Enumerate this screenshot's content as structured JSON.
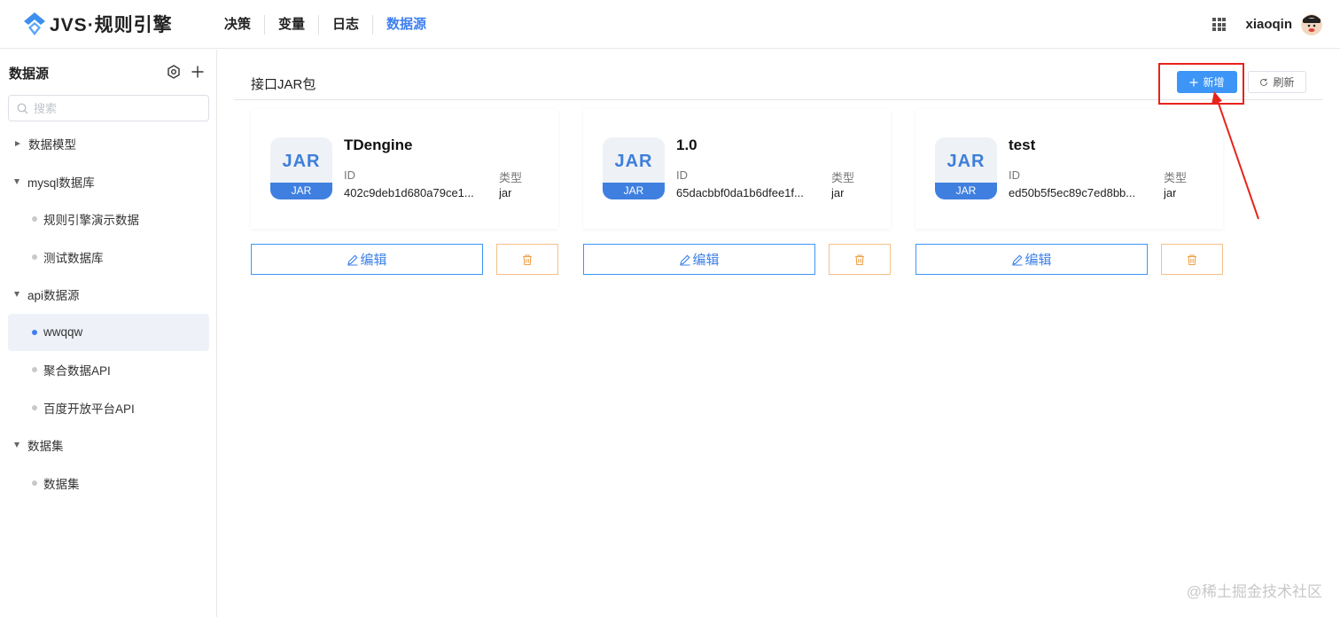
{
  "app": {
    "logo_text": "JVS·规则引擎"
  },
  "nav": {
    "items": [
      "决策",
      "变量",
      "日志",
      "数据源"
    ],
    "active_index": 3
  },
  "user": {
    "name": "xiaoqin"
  },
  "sidebar": {
    "title": "数据源",
    "search_placeholder": "搜索",
    "tree": [
      {
        "label": "数据模型",
        "type": "group",
        "expanded": false
      },
      {
        "label": "mysql数据库",
        "type": "group",
        "expanded": true
      },
      {
        "label": "规则引擎演示数据",
        "type": "leaf"
      },
      {
        "label": "测试数据库",
        "type": "leaf"
      },
      {
        "label": "api数据源",
        "type": "group",
        "expanded": true
      },
      {
        "label": "wwqqw",
        "type": "leaf",
        "selected": true
      },
      {
        "label": "聚合数据API",
        "type": "leaf"
      },
      {
        "label": "百度开放平台API",
        "type": "leaf"
      },
      {
        "label": "数据集",
        "type": "group",
        "expanded": true
      },
      {
        "label": "数据集",
        "type": "leaf"
      }
    ]
  },
  "panel": {
    "title": "接口JAR包",
    "add_label": "新增",
    "refresh_label": "刷新"
  },
  "cards": [
    {
      "jar_big": "JAR",
      "jar_band": "JAR",
      "name": "TDengine",
      "id_label": "ID",
      "id_value": "402c9deb1d680a79ce1...",
      "type_label": "类型",
      "type_value": "jar",
      "edit_label": "编辑"
    },
    {
      "jar_big": "JAR",
      "jar_band": "JAR",
      "name": "1.0",
      "id_label": "ID",
      "id_value": "65dacbbf0da1b6dfee1f...",
      "type_label": "类型",
      "type_value": "jar",
      "edit_label": "编辑"
    },
    {
      "jar_big": "JAR",
      "jar_band": "JAR",
      "name": "test",
      "id_label": "ID",
      "id_value": "ed50b5f5ec89c7ed8bb...",
      "type_label": "类型",
      "type_value": "jar",
      "edit_label": "编辑"
    }
  ],
  "watermark": "@稀土掘金技术社区",
  "colors": {
    "accent": "#3d96f7",
    "active_nav": "#3d7ff0",
    "delete_border": "#f5c089",
    "annotation": "#e8231c"
  }
}
